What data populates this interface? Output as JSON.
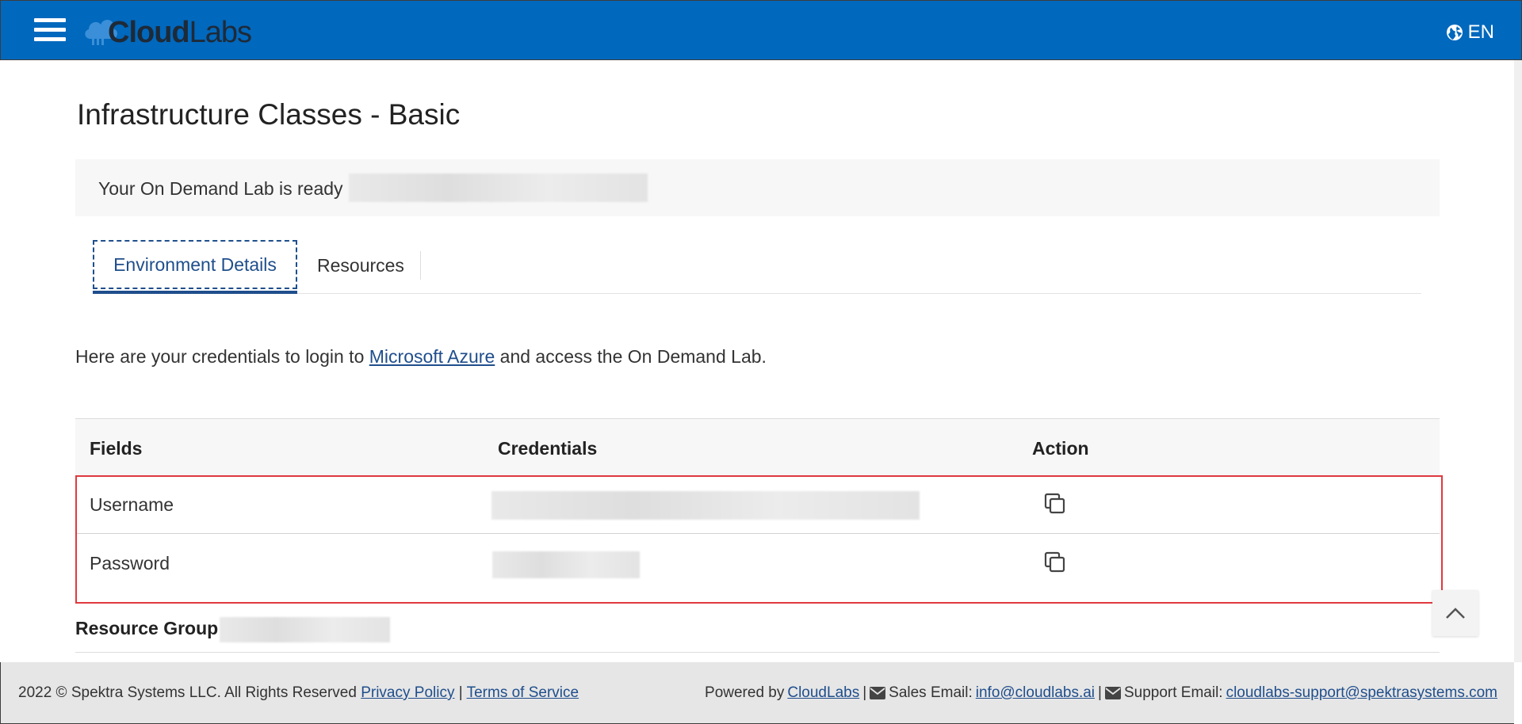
{
  "header": {
    "logo_bold": "Cloud",
    "logo_light": "Labs",
    "language": "EN",
    "colors": {
      "bar": "#0068bd",
      "text": "#ffffff"
    }
  },
  "page": {
    "title": "Infrastructure Classes - Basic",
    "ready_text": "Your On Demand Lab is ready"
  },
  "tabs": [
    {
      "label": "Environment Details",
      "active": true
    },
    {
      "label": "Resources",
      "active": false
    }
  ],
  "intro": {
    "before": "Here are your credentials to login to ",
    "link": "Microsoft Azure",
    "after": " and access the On Demand Lab."
  },
  "table": {
    "headers": {
      "fields": "Fields",
      "credentials": "Credentials",
      "action": "Action"
    },
    "rows": [
      {
        "field": "Username",
        "copy_icon": "copy-icon"
      },
      {
        "field": "Password",
        "copy_icon": "copy-icon"
      }
    ]
  },
  "resource_group": {
    "label": "Resource Group :"
  },
  "footer": {
    "copyright": "2022 © Spektra Systems LLC. All Rights Reserved",
    "privacy": "Privacy Policy",
    "sep": "|",
    "terms": "Terms of Service",
    "powered_by": "Powered by",
    "cloudlabs": "CloudLabs",
    "sales_label": "Sales Email:",
    "sales_email": "info@cloudlabs.ai",
    "support_label": "Support Email:",
    "support_email": "cloudlabs-support@spektrasystems.com"
  },
  "colors": {
    "accent": "#1f4e8c",
    "highlight": "#e0393e"
  }
}
